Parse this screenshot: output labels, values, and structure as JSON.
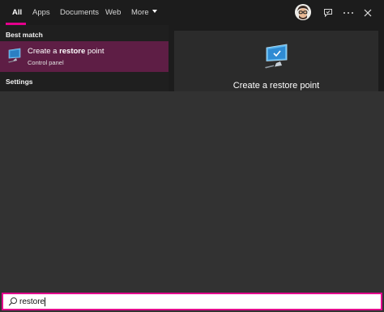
{
  "tabs": [
    {
      "label": "All",
      "active": true
    },
    {
      "label": "Apps"
    },
    {
      "label": "Documents"
    },
    {
      "label": "Web"
    },
    {
      "label": "More"
    }
  ],
  "toolbar": {
    "avatar_icon": "user-avatar",
    "feedback_icon": "feedback-icon",
    "options_icon": "more-options-icon",
    "close_icon": "close-icon"
  },
  "sections": {
    "best_match": "Best match",
    "settings": "Settings"
  },
  "best_match_result": {
    "title_prefix": "Create a ",
    "title_bold": "restore",
    "title_suffix": " point",
    "subtitle": "Control panel",
    "icon": "computer-check-icon"
  },
  "preview": {
    "title": "Create a restore point",
    "icon": "computer-check-icon"
  },
  "search": {
    "value": "restore",
    "icon": "search-icon"
  },
  "colors": {
    "accent": "#e3008c",
    "selected_result": "#5e1e45",
    "panel_dark": "#1c1c1c",
    "body_bg": "#323232"
  }
}
